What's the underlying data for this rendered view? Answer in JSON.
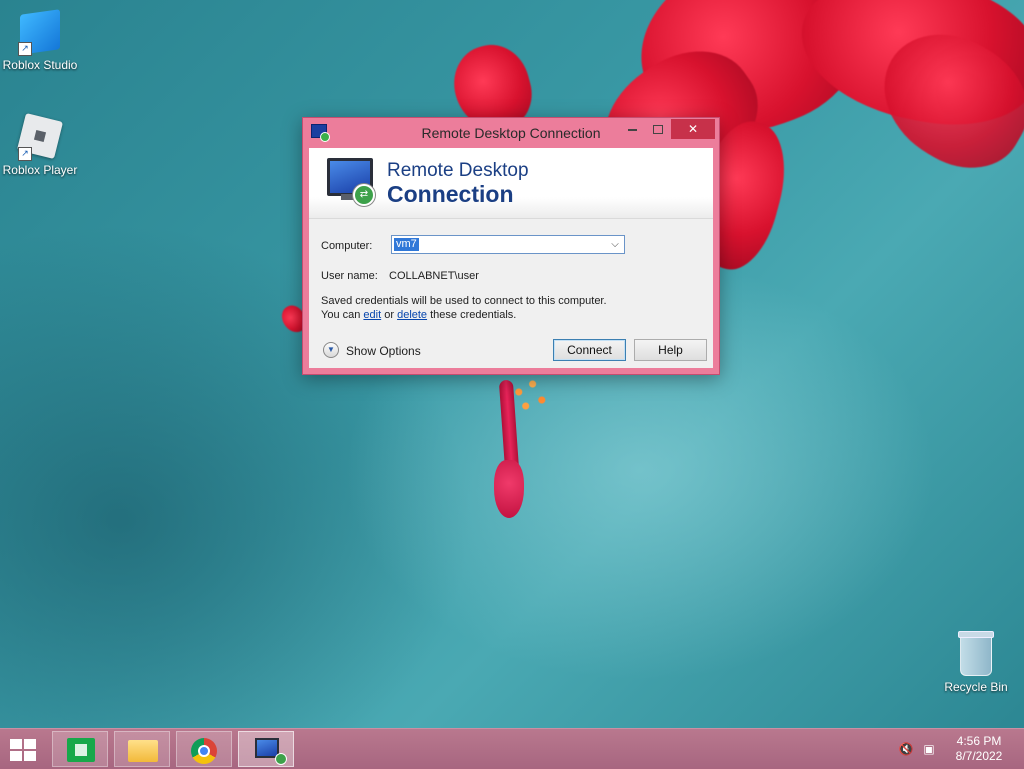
{
  "desktop": {
    "icons": [
      {
        "label": "Roblox Studio",
        "icon": "roblox-studio-icon"
      },
      {
        "label": "Roblox Player",
        "icon": "roblox-player-icon"
      },
      {
        "label": "Recycle Bin",
        "icon": "recycle-bin-icon"
      }
    ]
  },
  "window": {
    "title": "Remote Desktop Connection",
    "banner_line1": "Remote Desktop",
    "banner_line2": "Connection",
    "computer_label": "Computer:",
    "computer_value": "vm7",
    "username_label": "User name:",
    "username_value": "COLLABNET\\user",
    "creds_line1": "Saved credentials will be used to connect to this computer.",
    "creds_you_can": "You can ",
    "creds_edit": "edit",
    "creds_or": " or ",
    "creds_delete": "delete",
    "creds_tail": " these credentials.",
    "show_options": "Show Options",
    "connect": "Connect",
    "help": "Help",
    "accent_color": "#ec7d9b"
  },
  "taskbar": {
    "pinned": [
      "start-button",
      "store-icon",
      "file-explorer-icon",
      "chrome-icon",
      "remote-desktop-icon"
    ],
    "time": "4:56 PM",
    "date": "8/7/2022",
    "color": "#a76680"
  }
}
